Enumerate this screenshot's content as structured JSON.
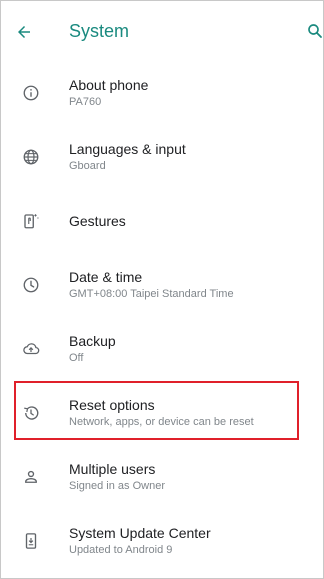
{
  "header": {
    "title": "System",
    "back_icon": "arrow-left-icon",
    "search_icon": "search-icon"
  },
  "colors": {
    "accent": "#1a8a7f",
    "highlight": "#e0202a",
    "icon": "#5f6368",
    "text_primary": "#202124",
    "text_secondary": "#80868b"
  },
  "items": [
    {
      "label": "About phone",
      "sub": "PA760",
      "icon": "info-icon"
    },
    {
      "label": "Languages & input",
      "sub": "Gboard",
      "icon": "globe-icon"
    },
    {
      "label": "Gestures",
      "sub": "",
      "icon": "gestures-icon"
    },
    {
      "label": "Date & time",
      "sub": "GMT+08:00 Taipei Standard Time",
      "icon": "clock-icon"
    },
    {
      "label": "Backup",
      "sub": "Off",
      "icon": "cloud-upload-icon"
    },
    {
      "label": "Reset options",
      "sub": "Network, apps, or device can be reset",
      "icon": "history-icon"
    },
    {
      "label": "Multiple users",
      "sub": "Signed in as Owner",
      "icon": "person-icon"
    },
    {
      "label": "System Update Center",
      "sub": "Updated to Android 9",
      "icon": "system-update-icon"
    }
  ]
}
